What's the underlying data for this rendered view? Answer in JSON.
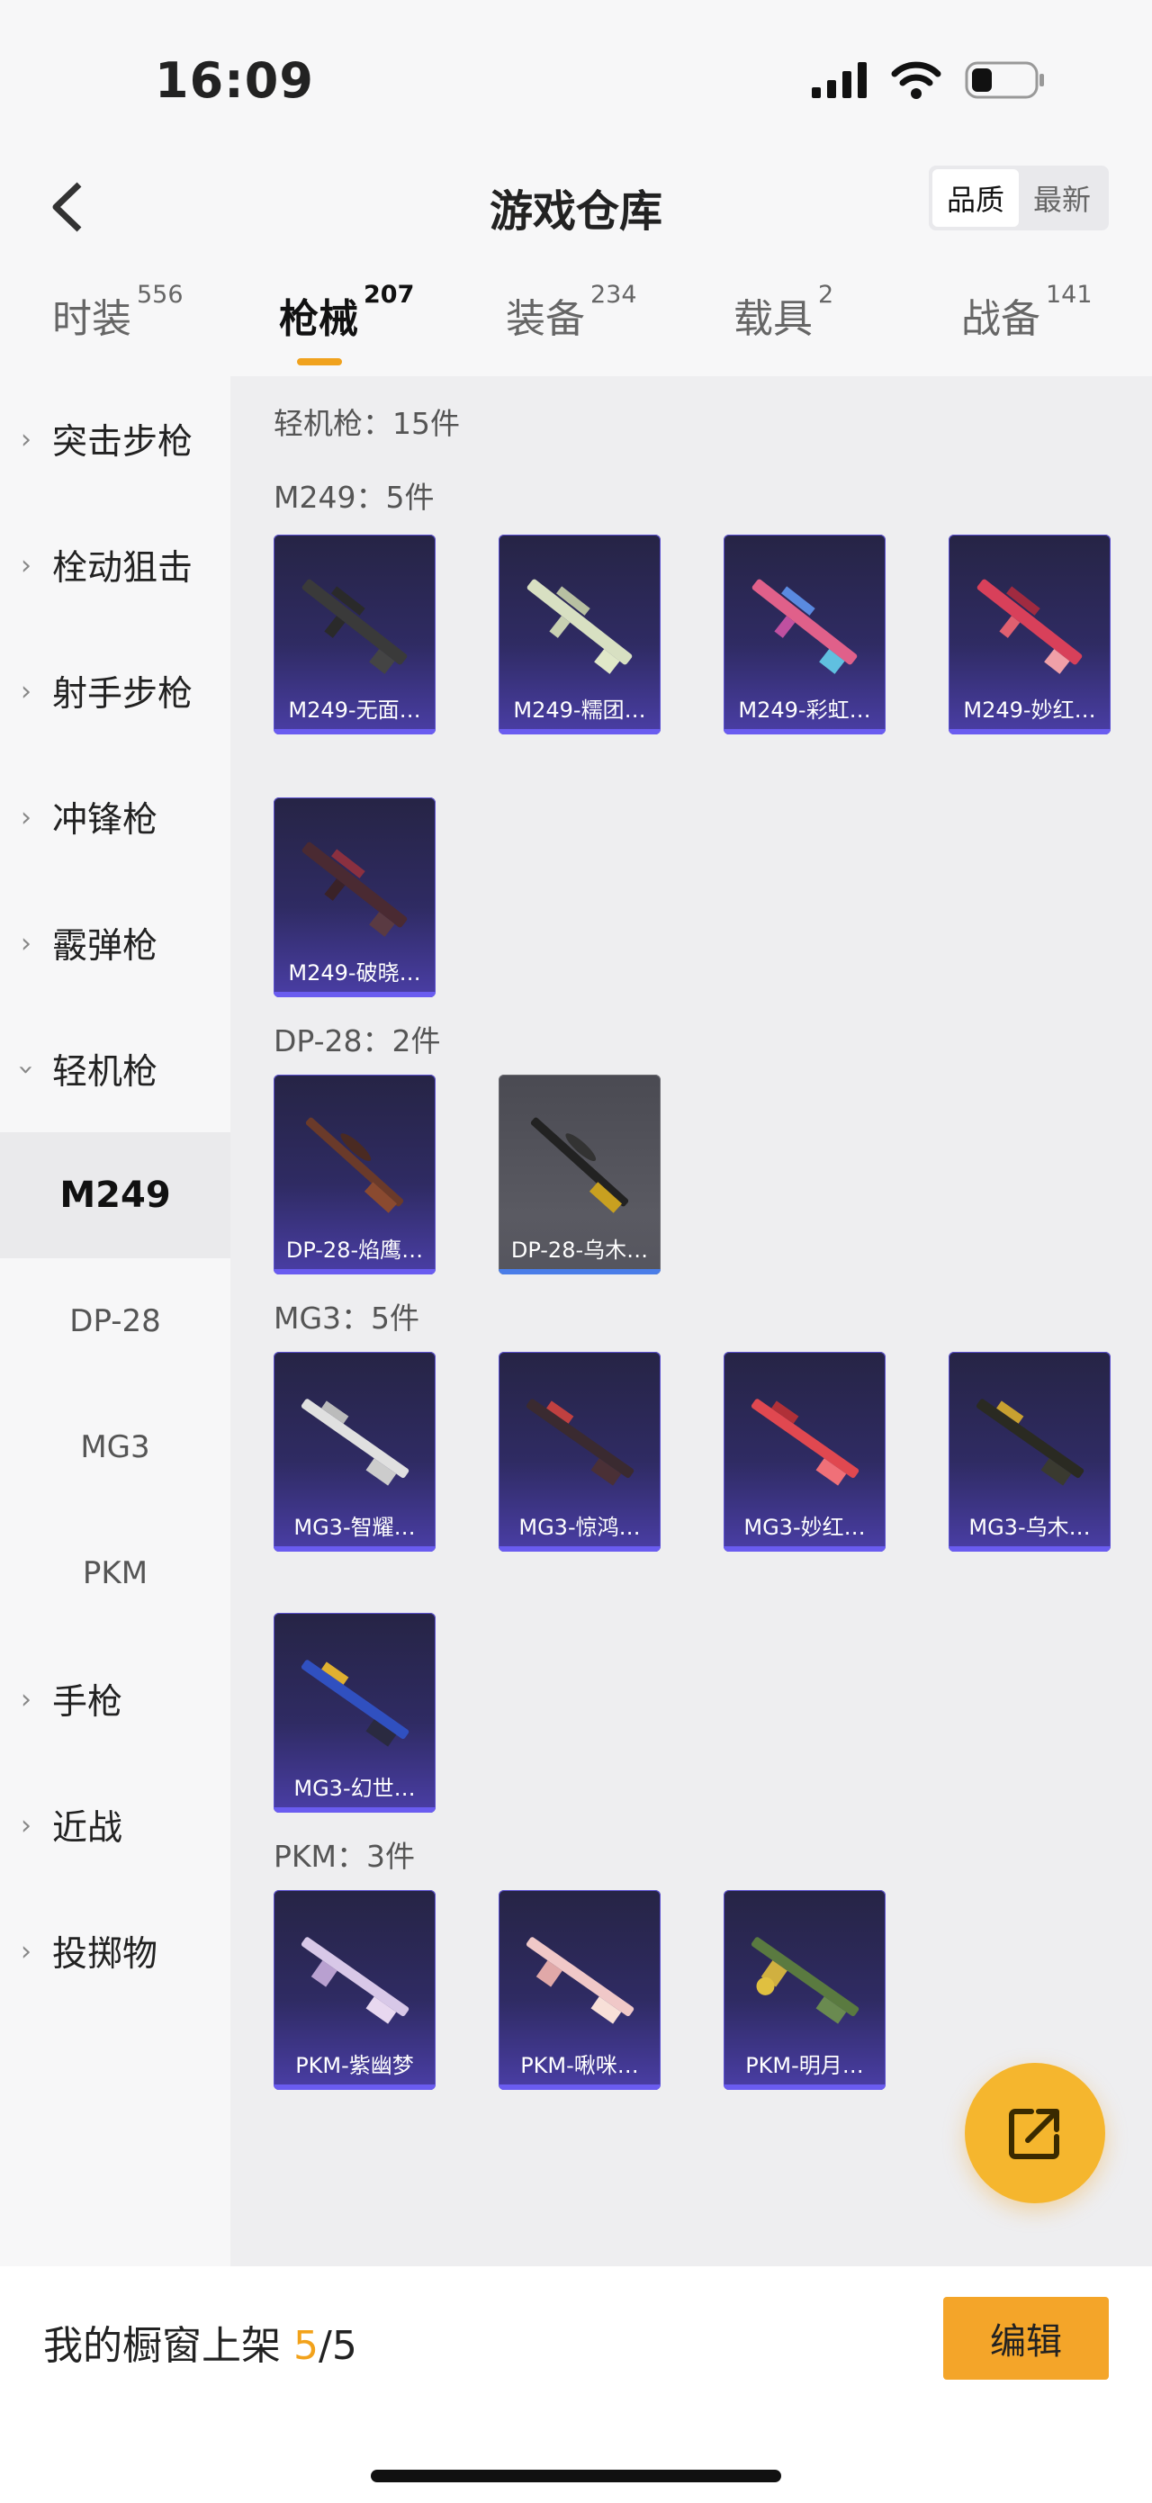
{
  "status": {
    "time": "16:09"
  },
  "header": {
    "title": "游戏仓库",
    "sort": [
      "品质",
      "最新"
    ]
  },
  "tabs": [
    {
      "label": "时装",
      "count": "556"
    },
    {
      "label": "枪械",
      "count": "207"
    },
    {
      "label": "装备",
      "count": "234"
    },
    {
      "label": "载具",
      "count": "2"
    },
    {
      "label": "战备",
      "count": "141"
    }
  ],
  "sidebar": {
    "items": [
      "突击步枪",
      "栓动狙击",
      "射手步枪",
      "冲锋枪",
      "霰弹枪",
      "轻机枪"
    ],
    "subitems": [
      "M249",
      "DP-28",
      "MG3",
      "PKM"
    ],
    "items_after": [
      "手枪",
      "近战",
      "投掷物"
    ]
  },
  "main": {
    "summary": "轻机枪：15件",
    "groups": [
      {
        "label": "M249：5件",
        "items": [
          "M249-无面…",
          "M249-糯团…",
          "M249-彩虹…",
          "M249-妙红…",
          "M249-破晓…"
        ]
      },
      {
        "label": "DP-28：2件",
        "items": [
          "DP-28-焰鹰…",
          "DP-28-乌木…"
        ]
      },
      {
        "label": "MG3：5件",
        "items": [
          "MG3-智耀…",
          "MG3-惊鸿…",
          "MG3-妙红…",
          "MG3-乌木…",
          "MG3-幻世…"
        ]
      },
      {
        "label": "PKM：3件",
        "items": [
          "PKM-紫幽梦",
          "PKM-啾咪…",
          "PKM-明月…"
        ]
      }
    ]
  },
  "bottom": {
    "prefix": "我的橱窗上架 ",
    "count": "5",
    "total": "/5",
    "edit_label": "编辑"
  },
  "colors": {
    "accent": "#f4a529",
    "card_purple": "#2f2b63",
    "card_gray": "#55555e"
  }
}
